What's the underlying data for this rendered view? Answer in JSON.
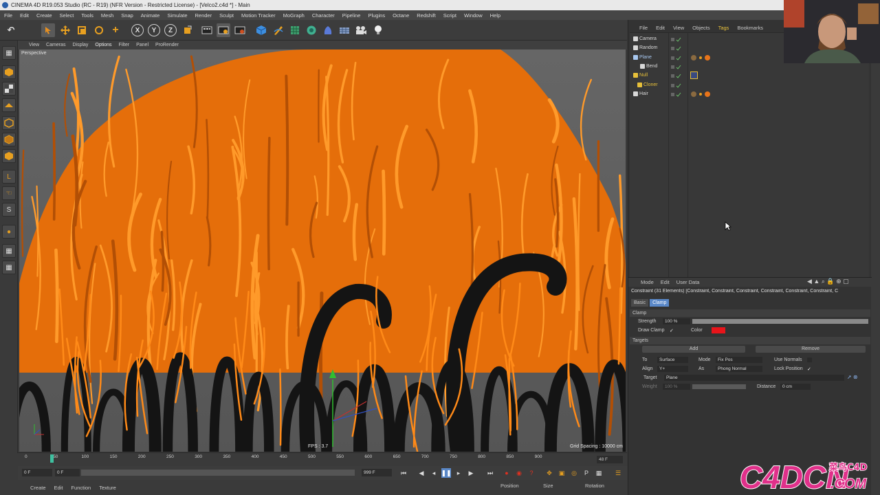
{
  "window": {
    "title": "CINEMA 4D R19.053 Studio (RC - R19) (NFR Version - Restricted License) - [Velco2.c4d *] - Main"
  },
  "menubar": [
    "File",
    "Edit",
    "Create",
    "Select",
    "Tools",
    "Mesh",
    "Snap",
    "Animate",
    "Simulate",
    "Render",
    "Sculpt",
    "Motion Tracker",
    "MoGraph",
    "Character",
    "Pipeline",
    "Plugins",
    "Octane",
    "Redshift",
    "Script",
    "Window",
    "Help"
  ],
  "toolbar": {
    "axis_x": "X",
    "axis_y": "Y",
    "axis_z": "Z"
  },
  "viewport": {
    "menu": [
      "View",
      "Cameras",
      "Display",
      "Options",
      "Filter",
      "Panel",
      "ProRender"
    ],
    "active_menu": "Options",
    "label": "Perspective",
    "fps": "FPS : 3.7",
    "grid_spacing": "Grid Spacing : 10000 cm",
    "colors": {
      "hair": "#f07a10",
      "velcro": "#1a1a1a",
      "background": "#5c5c5c"
    }
  },
  "timeline": {
    "ticks": [
      "0",
      "50",
      "100",
      "150",
      "200",
      "250",
      "300",
      "350",
      "400",
      "450",
      "500",
      "550",
      "600",
      "650",
      "700",
      "750",
      "800",
      "850",
      "900"
    ],
    "end_label": "48 F",
    "current_frame": "0 F",
    "min_field": "0 F",
    "max_field": "999 F"
  },
  "bottom": {
    "tabs": [
      "Create",
      "Edit",
      "Function",
      "Texture"
    ],
    "coords": {
      "position": "Position",
      "size": "Size",
      "rotation": "Rotation"
    }
  },
  "objects": {
    "menu": [
      "File",
      "Edit",
      "View",
      "Objects",
      "Tags",
      "Bookmarks"
    ],
    "items": [
      {
        "name": "Camera"
      },
      {
        "name": "Random"
      },
      {
        "name": "Plane"
      },
      {
        "name": "Bend"
      },
      {
        "name": "Null"
      },
      {
        "name": "Cloner"
      },
      {
        "name": "Hair"
      }
    ]
  },
  "attributes": {
    "menu": [
      "Mode",
      "Edit",
      "User Data"
    ],
    "title": "Constraint (31 Elements) [Constraint, Constraint, Constraint, Constraint, Constraint, Constraint, C",
    "tabs": [
      "Basic",
      "Clamp"
    ],
    "section_clamp": "Clamp",
    "strength_label": "Strength",
    "strength_value": "100 %",
    "strength_fraction": 1.0,
    "draw_clamp_label": "Draw Clamp",
    "draw_clamp_check": "✓",
    "color_label": "Color",
    "clamp_color": "#e8141a",
    "section_targets": "Targets",
    "add_label": "Add",
    "remove_label": "Remove",
    "to_label": "To",
    "to_value": "Surface",
    "mode_label": "Mode",
    "mode_value": "Fix Pos",
    "use_normals_label": "Use Normals",
    "align_label": "Align",
    "align_value": "Y+",
    "as_label": "As",
    "as_value": "Phong Normal",
    "lock_position_label": "Lock Position",
    "lock_position_check": "✓",
    "target_label": "Target",
    "target_value": "Plane",
    "weight_label": "Weight",
    "weight_value": "100 %",
    "distance_label": "Distance",
    "distance_value": "0 cm"
  },
  "logo": {
    "text": "C4DCN.COM",
    "cn": "菜鸟C4D"
  }
}
